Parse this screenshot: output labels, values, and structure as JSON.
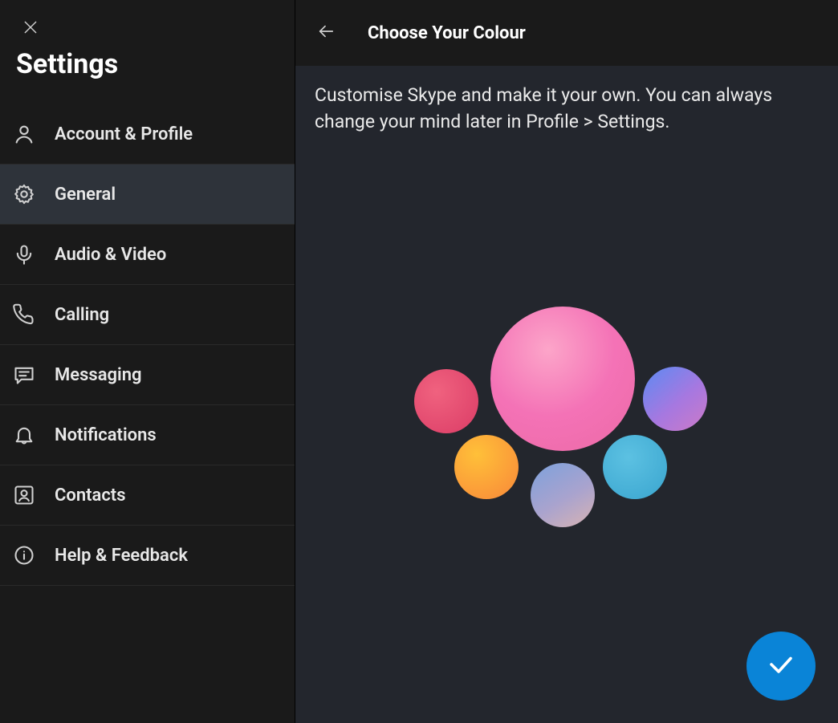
{
  "sidebar": {
    "title": "Settings",
    "items": [
      {
        "label": "Account & Profile",
        "icon": "person-icon"
      },
      {
        "label": "General",
        "icon": "gear-icon",
        "active": true
      },
      {
        "label": "Audio & Video",
        "icon": "mic-icon"
      },
      {
        "label": "Calling",
        "icon": "phone-icon"
      },
      {
        "label": "Messaging",
        "icon": "message-icon"
      },
      {
        "label": "Notifications",
        "icon": "bell-icon"
      },
      {
        "label": "Contacts",
        "icon": "contact-icon"
      },
      {
        "label": "Help & Feedback",
        "icon": "info-icon"
      }
    ]
  },
  "main": {
    "title": "Choose Your Colour",
    "description": "Customise Skype and make it your own. You can always change your mind later in Profile > Settings.",
    "confirm_label": "Confirm"
  },
  "color_options": [
    {
      "name": "pink",
      "selected": true
    },
    {
      "name": "red"
    },
    {
      "name": "purple-blue"
    },
    {
      "name": "orange"
    },
    {
      "name": "teal"
    },
    {
      "name": "lavender-blue"
    }
  ],
  "colors": {
    "accent": "#0a84d7",
    "sidebar_bg": "#1a1a1a",
    "panel_bg": "#23262d"
  }
}
